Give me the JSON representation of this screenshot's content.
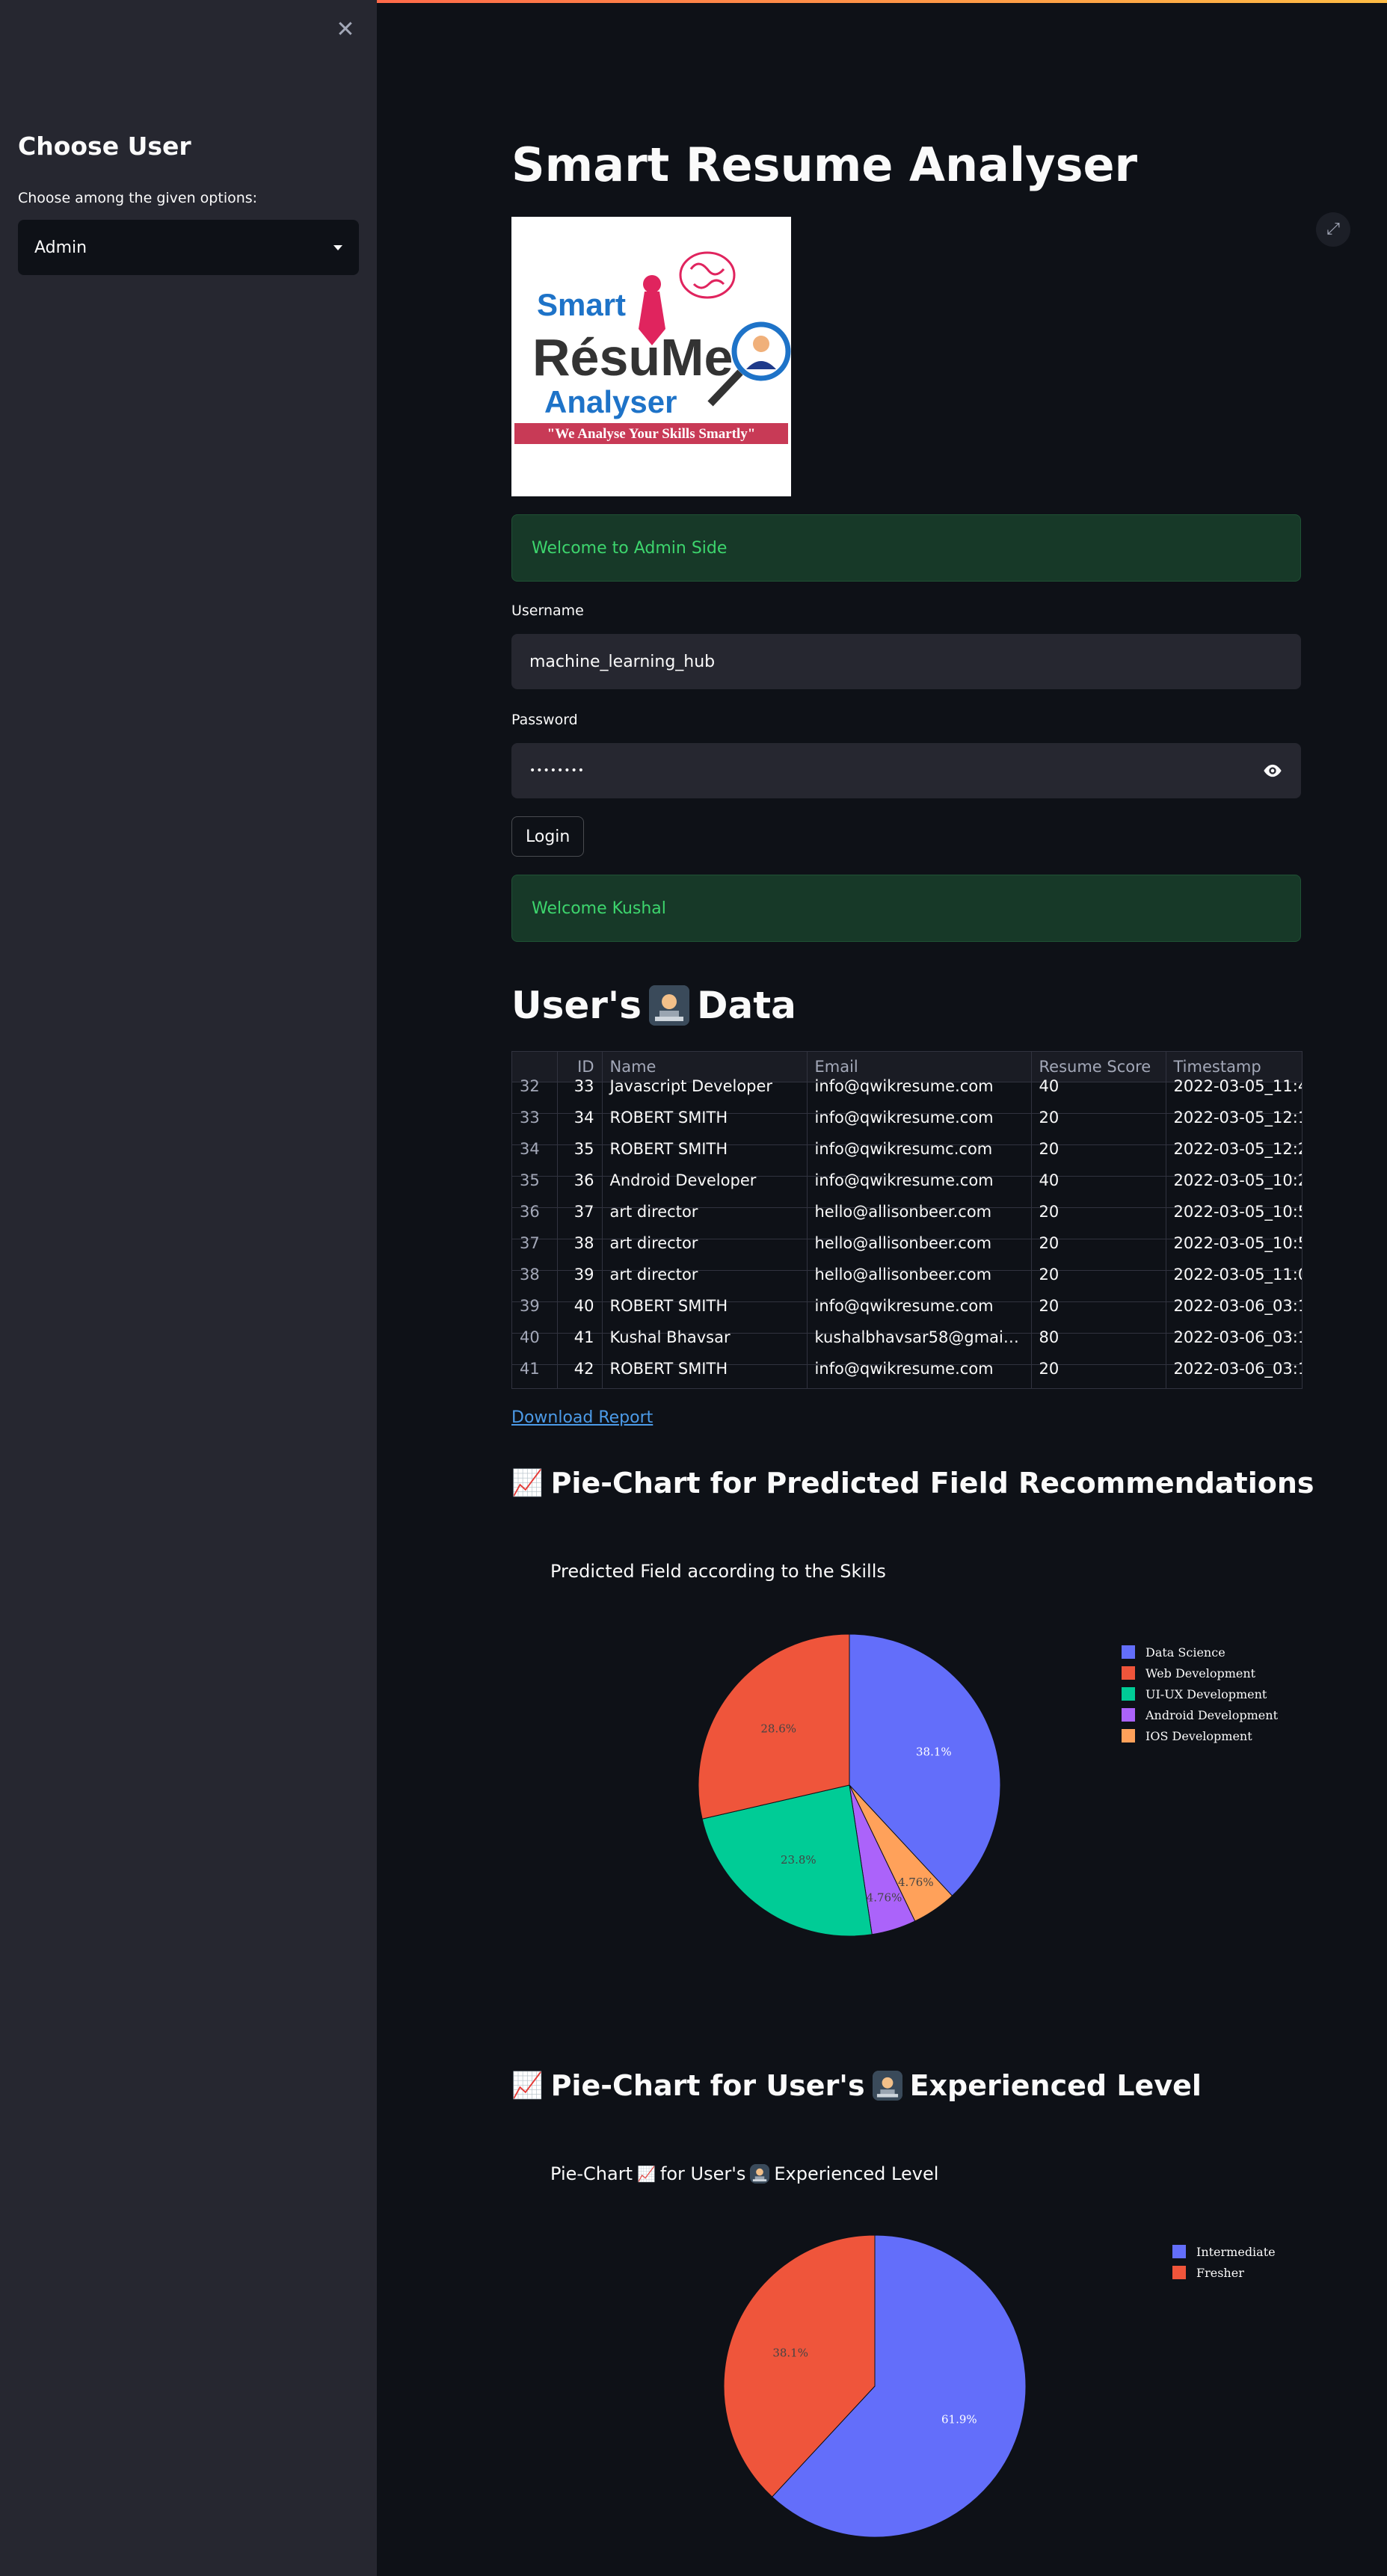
{
  "sidebar": {
    "title": "Choose User",
    "select_label": "Choose among the given options:",
    "selected": "Admin"
  },
  "main": {
    "title": "Smart Resume Analyser",
    "logo": {
      "line1": "Smart",
      "line2": "RésuMe",
      "line3": "Analyser",
      "tagline": "\"We Analyse Your Skills Smartly\""
    },
    "welcome_admin": "Welcome to Admin Side",
    "username_label": "Username",
    "username_value": "machine_learning_hub",
    "password_label": "Password",
    "password_value": "••••••••",
    "login_button": "Login",
    "welcome_user": "Welcome Kushal",
    "users_heading_pre": "User's",
    "users_heading_post": "Data",
    "download_link": "Download Report"
  },
  "table": {
    "columns": [
      "",
      "ID",
      "Name",
      "Email",
      "Resume Score",
      "Timestamp"
    ],
    "rows": [
      [
        "32",
        "33",
        "Javascript Developer",
        "info@qwikresume.com",
        "40",
        "2022-03-05_11:4"
      ],
      [
        "33",
        "34",
        "ROBERT SMITH",
        "info@qwikresume.com",
        "20",
        "2022-03-05_12:1"
      ],
      [
        "34",
        "35",
        "ROBERT SMITH",
        "info@qwikresumc.com",
        "20",
        "2022-03-05_12:2"
      ],
      [
        "35",
        "36",
        "Android Developer",
        "info@qwikresume.com",
        "40",
        "2022-03-05_10:2"
      ],
      [
        "36",
        "37",
        "art director",
        "hello@allisonbeer.com",
        "20",
        "2022-03-05_10:5"
      ],
      [
        "37",
        "38",
        "art director",
        "hello@allisonbeer.com",
        "20",
        "2022-03-05_10:5"
      ],
      [
        "38",
        "39",
        "art director",
        "hello@allisonbeer.com",
        "20",
        "2022-03-05_11:0"
      ],
      [
        "39",
        "40",
        "ROBERT SMITH",
        "info@qwikresume.com",
        "20",
        "2022-03-06_03:1"
      ],
      [
        "40",
        "41",
        "Kushal Bhavsar",
        "kushalbhavsar58@gmail.…",
        "80",
        "2022-03-06_03:1"
      ],
      [
        "41",
        "42",
        "ROBERT SMITH",
        "info@qwikresume.com",
        "20",
        "2022-03-06_03:1"
      ]
    ]
  },
  "section1": {
    "heading": "Pie-Chart for Predicted Field Recommendations"
  },
  "section2": {
    "heading_pre": "Pie-Chart for User's",
    "heading_post": "Experienced Level"
  },
  "chart_data": [
    {
      "type": "pie",
      "title": "Predicted Field according to the Skills",
      "legend_position": "top-right",
      "labels": [
        "Data Science",
        "Web Development",
        "UI-UX Development",
        "Android Development",
        "IOS Development"
      ],
      "values": [
        38.1,
        28.6,
        23.8,
        4.76,
        4.76
      ],
      "display_labels": [
        "38.1%",
        "28.6%",
        "23.8%",
        "4.76%",
        "4.76%"
      ],
      "slice_order": [
        0,
        4,
        3,
        2,
        1
      ],
      "colors": [
        "#636efa",
        "#ef553b",
        "#00cc96",
        "#ab63fa",
        "#ffa15a"
      ]
    },
    {
      "type": "pie",
      "title_pre": "Pie-Chart",
      "title_mid": "for User's",
      "title_post": "Experienced Level",
      "legend_position": "top-right",
      "labels": [
        "Intermediate",
        "Fresher"
      ],
      "values": [
        61.9,
        38.1
      ],
      "display_labels": [
        "61.9%",
        "38.1%"
      ],
      "slice_order": [
        0,
        1
      ],
      "colors": [
        "#636efa",
        "#ef553b"
      ]
    }
  ]
}
